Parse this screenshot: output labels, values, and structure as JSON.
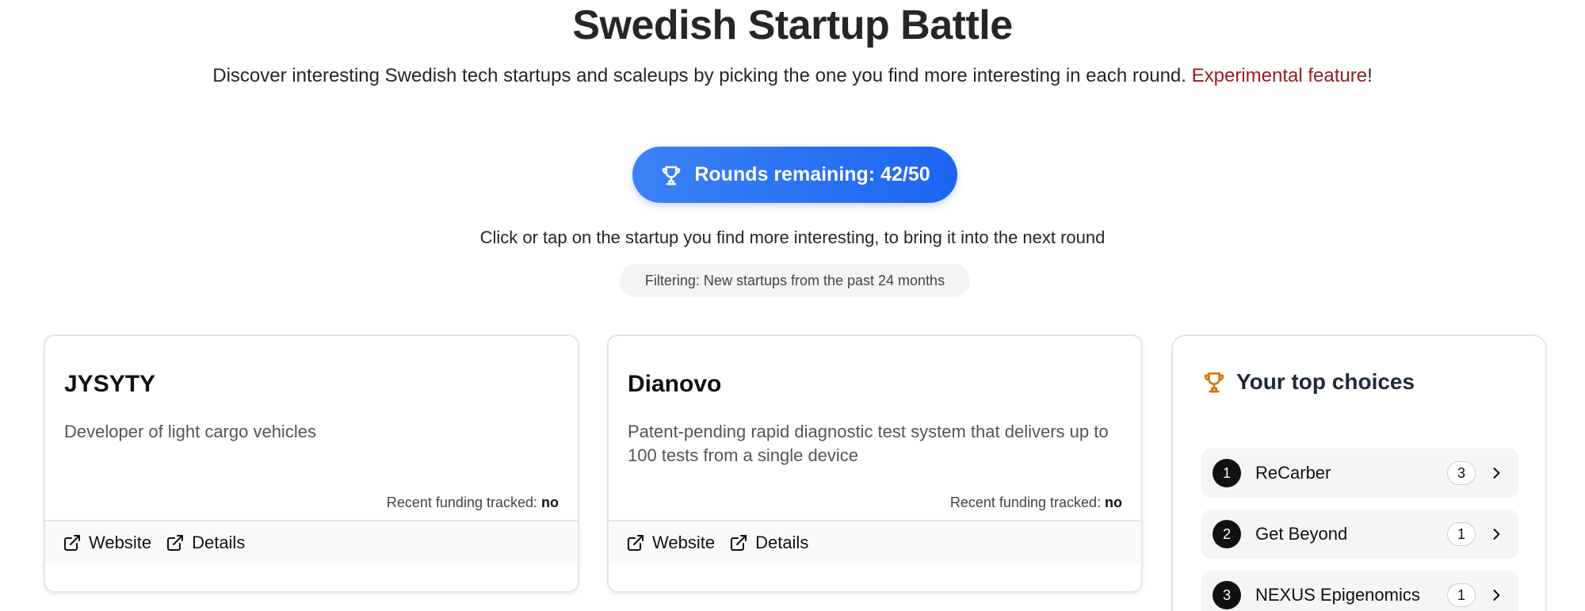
{
  "page": {
    "title": "Swedish Startup Battle",
    "subtitle_main": "Discover interesting Swedish tech startups and scaleups by picking the one you find more interesting in each round. ",
    "subtitle_link": "Experimental feature",
    "subtitle_end": "!"
  },
  "rounds": {
    "label": "Rounds remaining: 42/50",
    "icon": "trophy-icon"
  },
  "instruction": "Click or tap on the startup you find more interesting, to bring it into the next round",
  "filter": "Filtering: New startups from the past 24 months",
  "cards": [
    {
      "name": "JYSYTY",
      "description": "Developer of light cargo vehicles",
      "funding_label": "Recent funding tracked: ",
      "funding_value": "no",
      "website_label": "Website",
      "details_label": "Details"
    },
    {
      "name": "Dianovo",
      "description": "Patent-pending rapid diagnostic test system that delivers up to 100 tests from a single device",
      "funding_label": "Recent funding tracked: ",
      "funding_value": "no",
      "website_label": "Website",
      "details_label": "Details"
    }
  ],
  "top_choices": {
    "title": "Your top choices",
    "icon": "trophy-icon",
    "accent_color": "#d97706",
    "items": [
      {
        "rank": "1",
        "name": "ReCarber",
        "count": "3"
      },
      {
        "rank": "2",
        "name": "Get Beyond",
        "count": "1"
      },
      {
        "rank": "3",
        "name": "NEXUS Epigenomics",
        "count": "1"
      }
    ]
  },
  "colors": {
    "primary": "#2563eb",
    "experimental": "#991b1b"
  }
}
